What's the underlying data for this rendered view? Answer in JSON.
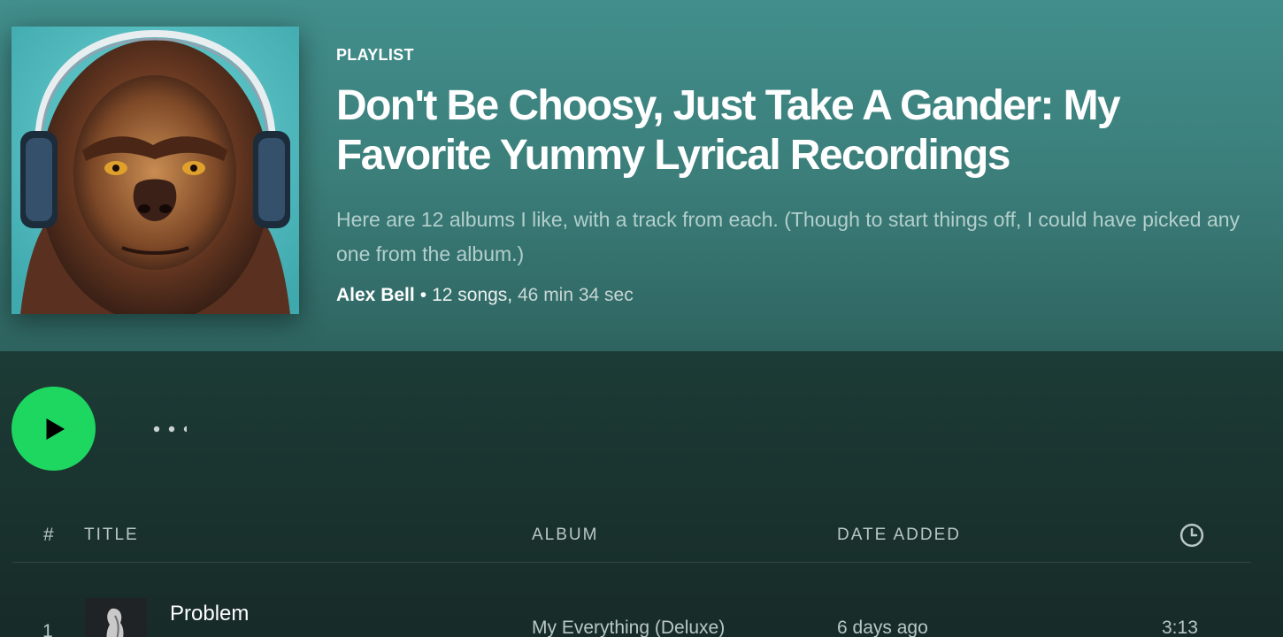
{
  "header": {
    "type_label": "PLAYLIST",
    "title": "Don't Be Choosy, Just Take A Gander: My Favorite Yummy Lyrical Recordings",
    "description": "Here are 12 albums I like, with a track from each. (Though to start things off, I could have picked any one from the album.)",
    "owner": "Alex Bell",
    "separator": "•",
    "song_count": "12 songs,",
    "duration": "46 min 34 sec",
    "cover_icon": "gorilla-with-headphones-artwork"
  },
  "actions": {
    "play_icon": "play-icon",
    "more_icon": "more-options-icon"
  },
  "table": {
    "columns": {
      "number": "#",
      "title": "TITLE",
      "album": "ALBUM",
      "date_added": "DATE ADDED",
      "duration_icon": "clock-icon"
    },
    "rows": [
      {
        "number": "1",
        "title": "Problem",
        "album": "My Everything (Deluxe)",
        "date_added": "6 days ago",
        "duration": "3:13"
      }
    ]
  },
  "colors": {
    "accent": "#1ed760",
    "header_bg": "#3b7e7a",
    "body_bg": "#1c3a35"
  }
}
